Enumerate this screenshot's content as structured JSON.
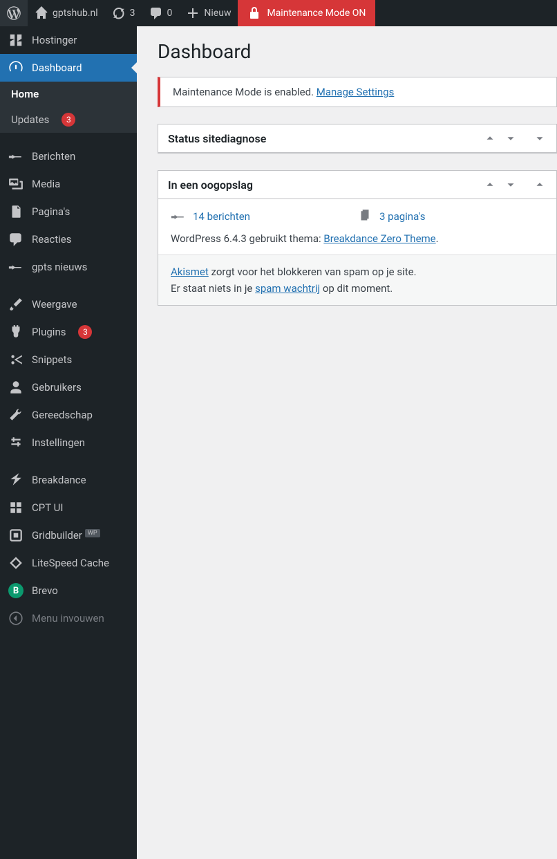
{
  "adminbar": {
    "site_name": "gptshub.nl",
    "updates_count": "3",
    "comments_count": "0",
    "new_label": "Nieuw",
    "maintenance_label": "Maintenance Mode ON"
  },
  "sidebar": {
    "hostinger": "Hostinger",
    "dashboard": "Dashboard",
    "home": "Home",
    "updates": "Updates",
    "updates_badge": "3",
    "berichten": "Berichten",
    "media": "Media",
    "paginas": "Pagina's",
    "reacties": "Reacties",
    "gpts_nieuws": "gpts nieuws",
    "weergave": "Weergave",
    "plugins": "Plugins",
    "plugins_badge": "3",
    "snippets": "Snippets",
    "gebruikers": "Gebruikers",
    "gereedschap": "Gereedschap",
    "instellingen": "Instellingen",
    "breakdance": "Breakdance",
    "cpt_ui": "CPT UI",
    "gridbuilder": "Gridbuilder",
    "gridbuilder_sup": "WP",
    "litespeed": "LiteSpeed Cache",
    "brevo": "Brevo",
    "collapse": "Menu invouwen"
  },
  "page": {
    "title": "Dashboard",
    "notice_text": "Maintenance Mode is enabled. ",
    "notice_link": "Manage Settings"
  },
  "postbox1": {
    "title": "Status sitediagnose"
  },
  "postbox2": {
    "title": "In een oogopslag",
    "posts_text": "14 berichten",
    "pages_text": "3 pagina's",
    "wp_prefix": "WordPress 6.4.3 gebruikt thema: ",
    "theme_link": "Breakdance Zero Theme",
    "akismet_link": "Akismet",
    "akismet_text": " zorgt voor het blokkeren van spam op je site.",
    "spam_prefix": "Er staat niets in je ",
    "spam_link": "spam wachtrij",
    "spam_suffix": " op dit moment."
  }
}
